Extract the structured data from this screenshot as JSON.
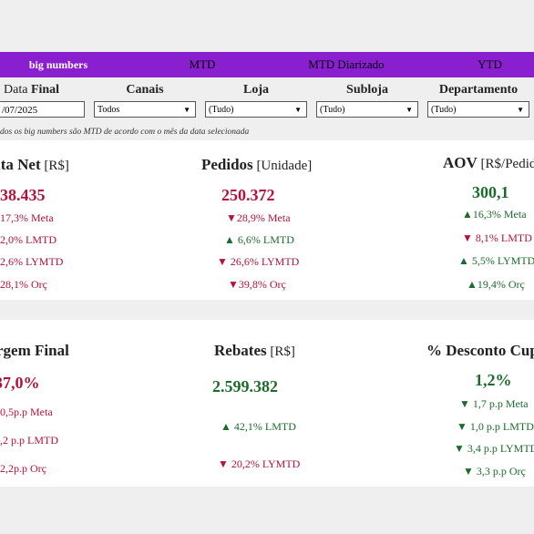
{
  "nav": {
    "tabs": [
      {
        "label": "big numbers",
        "active": true
      },
      {
        "label": "MTD"
      },
      {
        "label": "MTD Diarizado"
      },
      {
        "label": "YTD"
      }
    ]
  },
  "filters": {
    "data_final": {
      "label_a": "Data ",
      "label_b": "Final",
      "value": "/07/2025"
    },
    "canais": {
      "label": "Canais",
      "value": "Todos"
    },
    "loja": {
      "label": "Loja",
      "value": "(Tudo)"
    },
    "subloja": {
      "label": "Subloja",
      "value": "(Tudo)"
    },
    "departamento": {
      "label": "Departamento",
      "value": "(Tudo)"
    }
  },
  "note": "dos os big numbers são MTD de acordo com o mês da data selecionada",
  "colors": {
    "accent": "#8a1fcf",
    "negative": "#b3123a",
    "positive": "#1e6b2e"
  },
  "kpis_row1": {
    "receita": {
      "title": "ita Net",
      "unit": " [R$]",
      "value": "38.435",
      "m1": "17,3% Meta",
      "m2": "2,0% LMTD",
      "m3": "2,6% LYMTD",
      "m4": "28,1% Orç"
    },
    "pedidos": {
      "title": "Pedidos",
      "unit": " [Unidade]",
      "value": "250.372",
      "m1": "▼28,9% Meta",
      "m2": "▲ 6,6% LMTD",
      "m3": "▼ 26,6% LYMTD",
      "m4": "▼39,8% Orç"
    },
    "aov": {
      "title": "AOV",
      "unit": " [R$/Pedido]",
      "value": "300,1",
      "m1": "▲16,3% Meta",
      "m2": "▼ 8,1% LMTD",
      "m3": "▲ 5,5% LYMTD",
      "m4": "▲19,4% Orç"
    }
  },
  "kpis_row2": {
    "margem": {
      "title": "rgem Final",
      "value": "37,0%",
      "m1": "0,5p.p Meta",
      "m2": ",2 p.p LMTD",
      "m3": "2,2p.p Orç"
    },
    "rebates": {
      "title": "Rebates",
      "unit": " [R$]",
      "value": "2.599.382",
      "m1": "▲ 42,1% LMTD",
      "m2": "▼ 20,2% LYMTD"
    },
    "desconto": {
      "title": "% Desconto Cupom",
      "value": "1,2%",
      "m1": "▼ 1,7 p.p Meta",
      "m2": "▼ 1,0 p.p LMTD",
      "m3": "▼ 3,4 p.p LYMTD",
      "m4": "▼ 3,3 p.p Orç"
    }
  }
}
